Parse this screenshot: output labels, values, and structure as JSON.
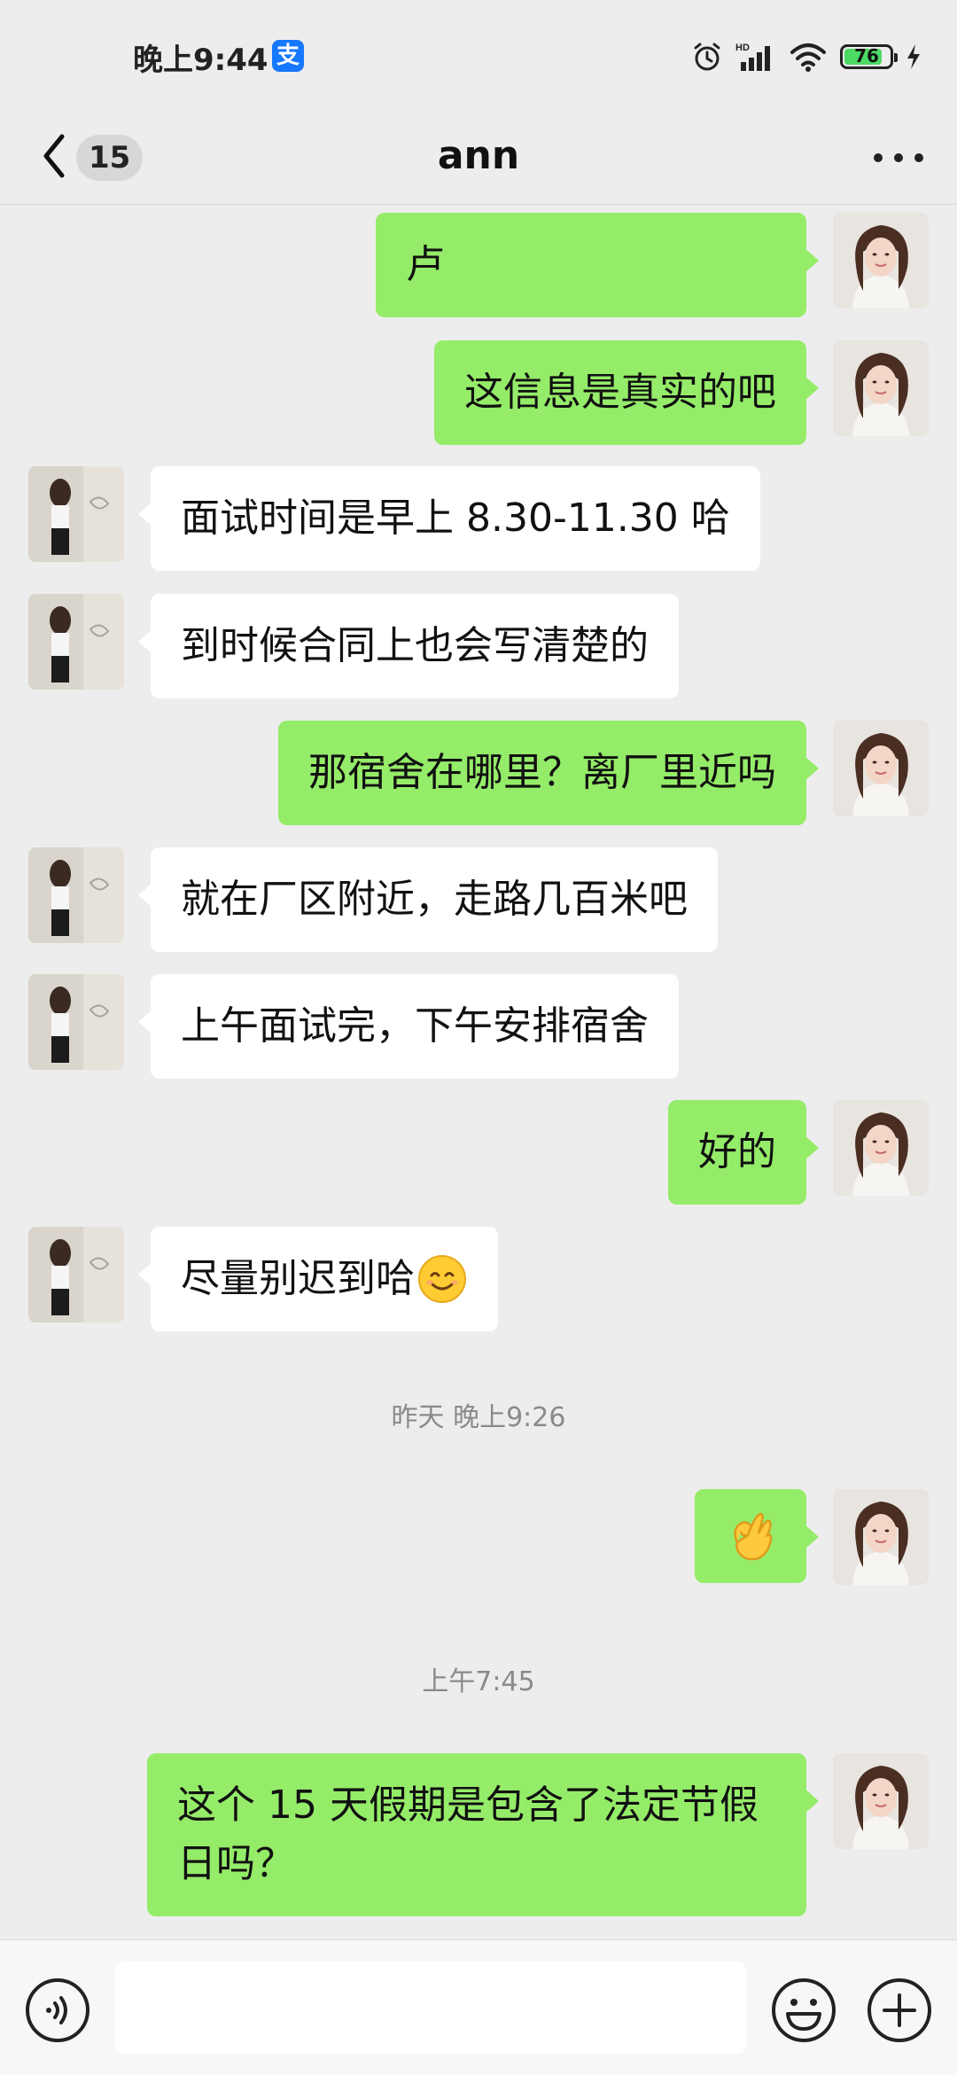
{
  "status_bar": {
    "time": "晚上9:44",
    "alipay_glyph": "支",
    "network_label": "HD",
    "battery_level": "76",
    "icons": [
      "alarm-icon",
      "signal-icon",
      "wifi-icon",
      "battery-icon",
      "charging-icon"
    ]
  },
  "header": {
    "unread_count": "15",
    "title": "ann"
  },
  "messages": [
    {
      "side": "out",
      "text": "卢"
    },
    {
      "side": "out",
      "text": "这信息是真实的吧"
    },
    {
      "side": "in",
      "text": "面试时间是早上 8.30-11.30 哈"
    },
    {
      "side": "in",
      "text": "到时候合同上也会写清楚的"
    },
    {
      "side": "out",
      "text": "那宿舍在哪里？离厂里近吗"
    },
    {
      "side": "in",
      "text": "就在厂区附近，走路几百米吧"
    },
    {
      "side": "in",
      "text": "上午面试完，下午安排宿舍"
    },
    {
      "side": "out",
      "text": "好的"
    },
    {
      "side": "in",
      "text": "尽量别迟到哈",
      "emoji": "smile-emoji"
    },
    {
      "type": "time",
      "text": "昨天 晚上9:26"
    },
    {
      "side": "out",
      "emoji": "ok-hand-emoji"
    },
    {
      "type": "time",
      "text": "上午7:45"
    },
    {
      "side": "out",
      "text": "这个 15 天假期是包含了法定节假日吗？"
    }
  ],
  "input": {
    "value": "",
    "icons": [
      "voice-icon",
      "emoji-icon",
      "plus-icon"
    ]
  },
  "colors": {
    "background": "#ededed",
    "outgoing_bubble": "#95ec69",
    "incoming_bubble": "#ffffff",
    "timestamp_text": "#8a8a8a",
    "battery_fill": "#4cd964",
    "alipay_blue": "#1677ff"
  }
}
